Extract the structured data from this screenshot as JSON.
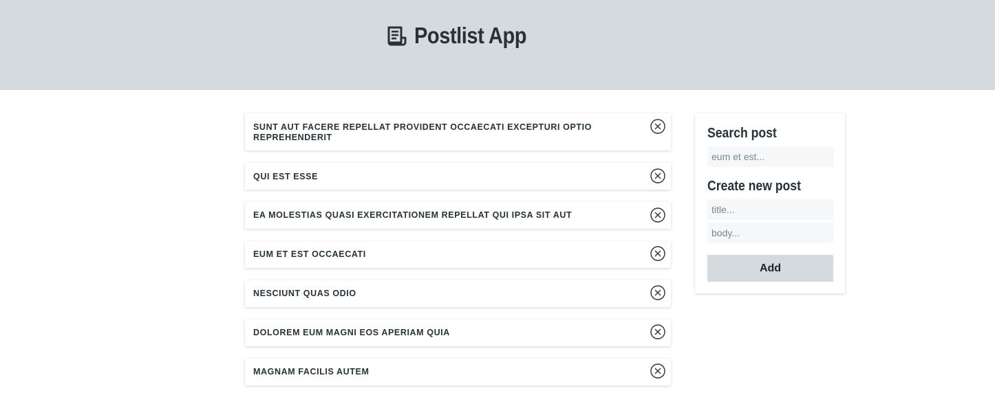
{
  "header": {
    "title": "Postlist App",
    "icon": "document-list-icon",
    "background": "#d4dadd"
  },
  "posts": [
    {
      "title": "sunt aut facere repellat provident occaecati excepturi optio reprehenderit"
    },
    {
      "title": "qui est esse"
    },
    {
      "title": "ea molestias quasi exercitationem repellat qui ipsa sit aut"
    },
    {
      "title": "eum et est occaecati"
    },
    {
      "title": "nesciunt quas odio"
    },
    {
      "title": "dolorem eum magni eos aperiam quia"
    },
    {
      "title": "magnam facilis autem"
    }
  ],
  "post_delete_icon": "circle-x-icon",
  "sidebar": {
    "search_heading": "Search post",
    "search_placeholder": "eum et est...",
    "create_heading": "Create new post",
    "title_placeholder": "title...",
    "body_placeholder": "body...",
    "add_label": "Add"
  }
}
